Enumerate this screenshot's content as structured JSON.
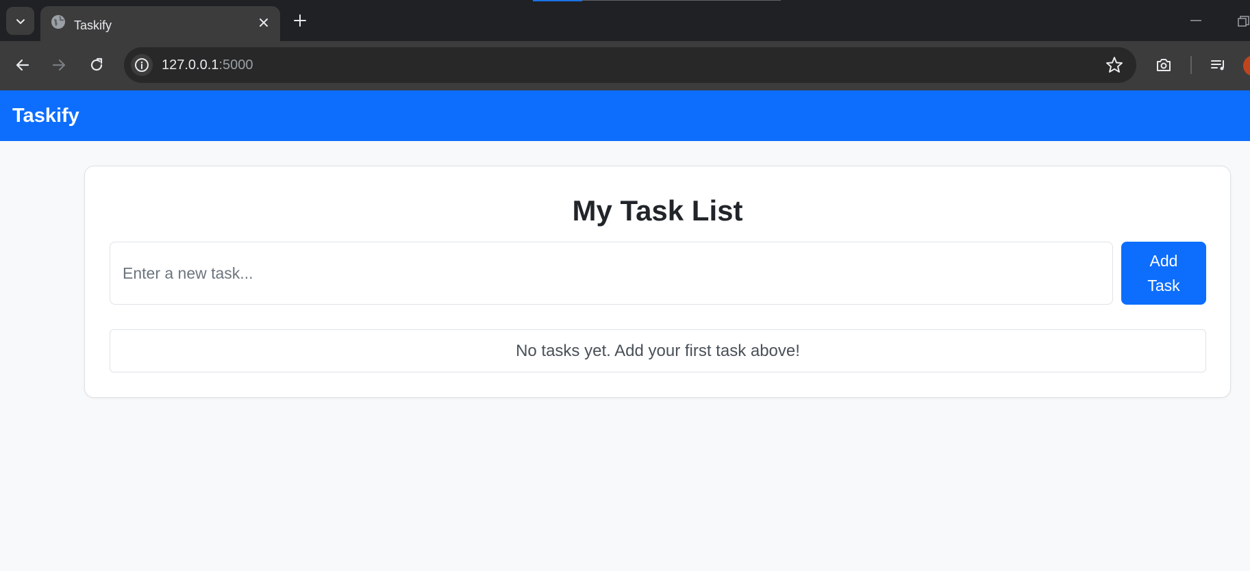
{
  "browser": {
    "tab": {
      "title": "Taskify",
      "favicon": "globe-icon"
    },
    "address_bar": {
      "host": "127.0.0.1",
      "port": ":5000"
    },
    "icons": {
      "tab_search": "chevron-down-icon",
      "tab_close": "close-icon",
      "new_tab": "plus-icon",
      "back": "arrow-left-icon",
      "forward": "arrow-right-icon",
      "reload": "reload-icon",
      "site_info": "info-icon",
      "bookmark": "star-icon",
      "screenshot": "camera-icon",
      "media": "queue-music-icon",
      "minimize": "minimize-icon",
      "restore": "restore-icon"
    }
  },
  "navbar": {
    "brand": "Taskify",
    "color": "#0d6efd"
  },
  "main": {
    "title": "My Task List",
    "input_placeholder": "Enter a new task...",
    "add_button_label": "Add Task",
    "empty_message": "No tasks yet. Add your first task above!"
  }
}
